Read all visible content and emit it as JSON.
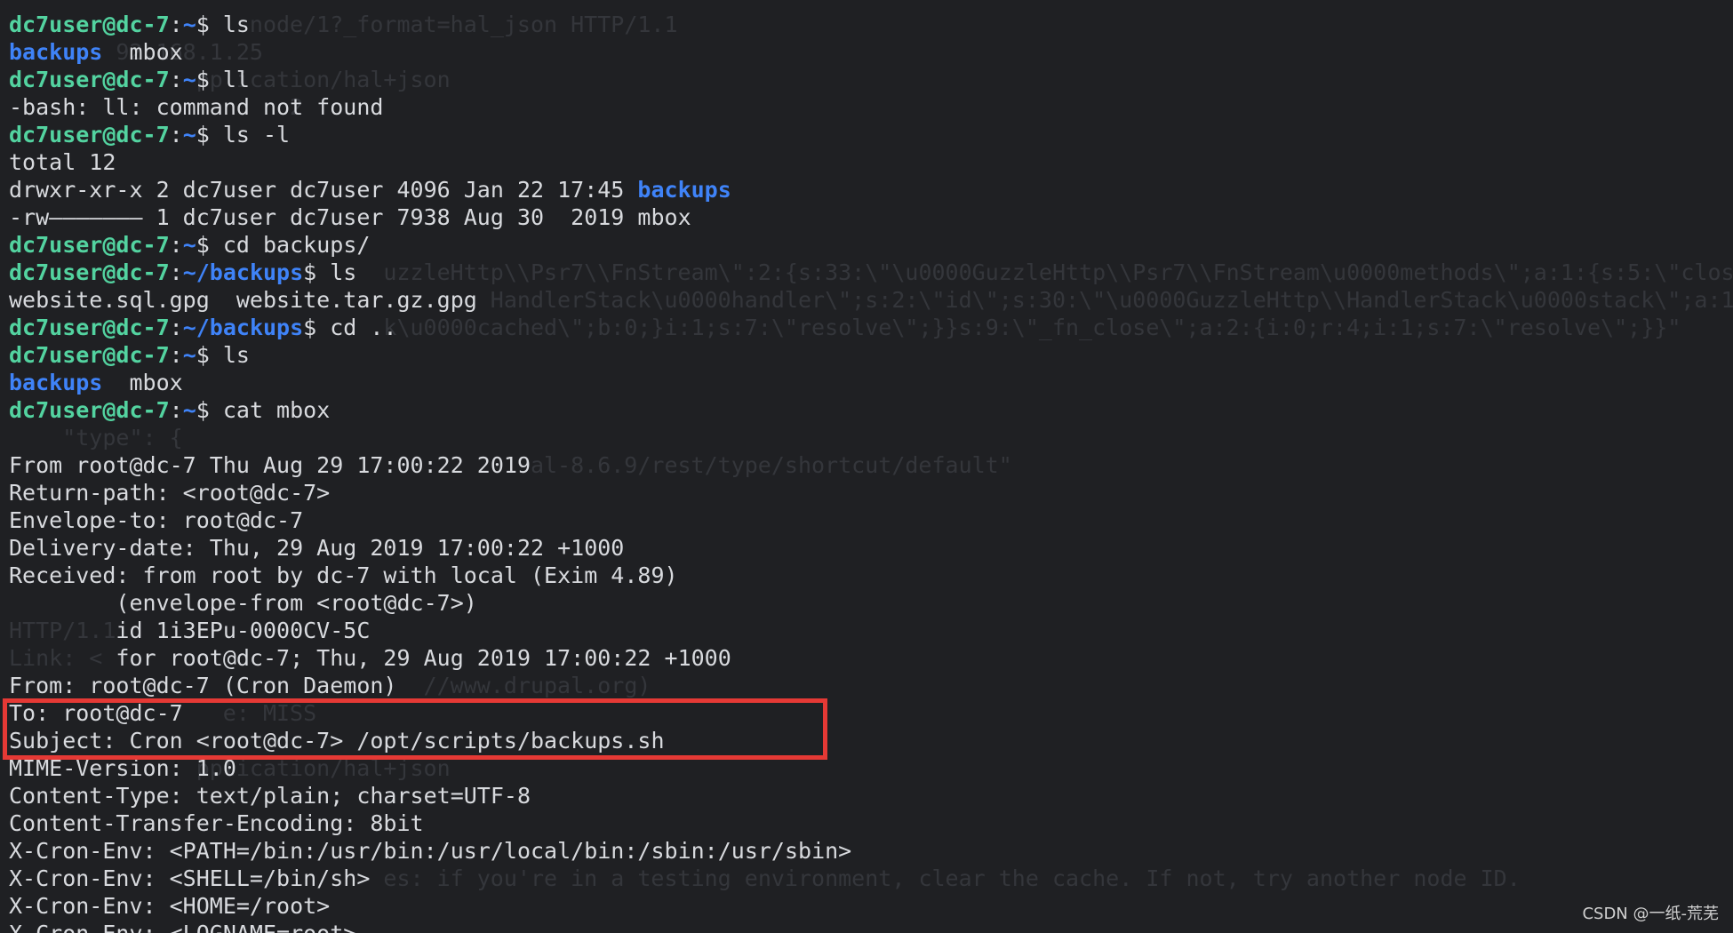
{
  "ghost_text": [
    {
      "row": 0,
      "col": 18,
      "text": "node/1?_format=hal_json HTTP/1.1"
    },
    {
      "row": 1,
      "col": 8,
      "text": "92.168.1.25"
    },
    {
      "row": 2,
      "col": 14,
      "text": "pplication/hal+json"
    },
    {
      "row": 3,
      "col": 21,
      "text": "2"
    },
    {
      "row": 9,
      "col": 28,
      "text": "uzzleHttp\\\\Psr7\\\\FnStream\\\":2:{s:33:\\\"\\u0000GuzzleHttp\\\\Psr7\\\\FnStream\\u0000methods\\\";a:1:{s:5:\\\"close\\\""
    },
    {
      "row": 10,
      "col": 36,
      "text": "HandlerStack\\u0000handler\\\";s:2:\\\"id\\\";s:30:\\\"\\u0000GuzzleHttp\\\\HandlerStack\\u0000stack\\\";a:1:"
    },
    {
      "row": 11,
      "col": 28,
      "text": "k\\u0000cached\\\";b:0;}i:1;s:7:\\\"resolve\\\";}}s:9:\\\"_fn_close\\\";a:2:{i:0;r:4;i:1;s:7:\\\"resolve\\\";}}\""
    },
    {
      "row": 15,
      "col": 4,
      "text": "\"type\": {"
    },
    {
      "row": 16,
      "col": 39,
      "text": "al-8.6.9/rest/type/shortcut/default\""
    },
    {
      "row": 22,
      "col": 0,
      "text": "HTTP/1.1"
    },
    {
      "row": 23,
      "col": 0,
      "text": "Link: <"
    },
    {
      "row": 24,
      "col": 31,
      "text": "//www.drupal.org)"
    },
    {
      "row": 25,
      "col": 16,
      "text": "e: MISS"
    },
    {
      "row": 27,
      "col": 14,
      "text": "pplication/hal+json"
    },
    {
      "row": 31,
      "col": 28,
      "text": "es: if you're in a testing environment, clear the cache. If not, try another node ID."
    }
  ],
  "lines": [
    [
      {
        "t": "dc7user@dc-7",
        "c": "prompt-user"
      },
      {
        "t": ":",
        "c": "prompt-colon"
      },
      {
        "t": "~",
        "c": "prompt-path"
      },
      {
        "t": "$ ls",
        "c": "prompt-dollar"
      }
    ],
    [
      {
        "t": "backups",
        "c": "dir"
      },
      {
        "t": "  mbox",
        "c": "plain"
      }
    ],
    [
      {
        "t": "dc7user@dc-7",
        "c": "prompt-user"
      },
      {
        "t": ":",
        "c": "prompt-colon"
      },
      {
        "t": "~",
        "c": "prompt-path"
      },
      {
        "t": "$ ll",
        "c": "prompt-dollar"
      }
    ],
    [
      {
        "t": "-bash: ll: command not found",
        "c": "plain"
      }
    ],
    [
      {
        "t": "dc7user@dc-7",
        "c": "prompt-user"
      },
      {
        "t": ":",
        "c": "prompt-colon"
      },
      {
        "t": "~",
        "c": "prompt-path"
      },
      {
        "t": "$ ls -l",
        "c": "prompt-dollar"
      }
    ],
    [
      {
        "t": "total 12",
        "c": "plain"
      }
    ],
    [
      {
        "t": "drwxr-xr-x 2 dc7user dc7user 4096 Jan 22 17:45 ",
        "c": "plain"
      },
      {
        "t": "backups",
        "c": "dir"
      }
    ],
    [
      {
        "t": "-rw——————— 1 dc7user dc7user 7938 Aug 30  2019 mbox",
        "c": "plain"
      }
    ],
    [
      {
        "t": "dc7user@dc-7",
        "c": "prompt-user"
      },
      {
        "t": ":",
        "c": "prompt-colon"
      },
      {
        "t": "~",
        "c": "prompt-path"
      },
      {
        "t": "$ cd backups/",
        "c": "prompt-dollar"
      }
    ],
    [
      {
        "t": "dc7user@dc-7",
        "c": "prompt-user"
      },
      {
        "t": ":",
        "c": "prompt-colon"
      },
      {
        "t": "~/backups",
        "c": "prompt-path"
      },
      {
        "t": "$ ls",
        "c": "prompt-dollar"
      }
    ],
    [
      {
        "t": "website.sql.gpg  website.tar.gz.gpg",
        "c": "plain"
      }
    ],
    [
      {
        "t": "dc7user@dc-7",
        "c": "prompt-user"
      },
      {
        "t": ":",
        "c": "prompt-colon"
      },
      {
        "t": "~/backups",
        "c": "prompt-path"
      },
      {
        "t": "$ cd ..",
        "c": "prompt-dollar"
      }
    ],
    [
      {
        "t": "dc7user@dc-7",
        "c": "prompt-user"
      },
      {
        "t": ":",
        "c": "prompt-colon"
      },
      {
        "t": "~",
        "c": "prompt-path"
      },
      {
        "t": "$ ls",
        "c": "prompt-dollar"
      }
    ],
    [
      {
        "t": "backups",
        "c": "dir"
      },
      {
        "t": "  mbox",
        "c": "plain"
      }
    ],
    [
      {
        "t": "dc7user@dc-7",
        "c": "prompt-user"
      },
      {
        "t": ":",
        "c": "prompt-colon"
      },
      {
        "t": "~",
        "c": "prompt-path"
      },
      {
        "t": "$ cat mbox",
        "c": "prompt-dollar"
      }
    ],
    [
      {
        "t": "",
        "c": "plain"
      }
    ],
    [
      {
        "t": "From root@dc-7 Thu Aug 29 17:00:22 2019",
        "c": "plain"
      }
    ],
    [
      {
        "t": "Return-path: <root@dc-7>",
        "c": "plain"
      }
    ],
    [
      {
        "t": "Envelope-to: root@dc-7",
        "c": "plain"
      }
    ],
    [
      {
        "t": "Delivery-date: Thu, 29 Aug 2019 17:00:22 +1000",
        "c": "plain"
      }
    ],
    [
      {
        "t": "Received: from root by dc-7 with local (Exim 4.89)",
        "c": "plain"
      }
    ],
    [
      {
        "t": "        (envelope-from <root@dc-7>)",
        "c": "plain"
      }
    ],
    [
      {
        "t": "        id 1i3EPu-0000CV-5C",
        "c": "plain"
      }
    ],
    [
      {
        "t": "        for root@dc-7; Thu, 29 Aug 2019 17:00:22 +1000",
        "c": "plain"
      }
    ],
    [
      {
        "t": "From: root@dc-7 (Cron Daemon)",
        "c": "plain"
      }
    ],
    [
      {
        "t": "To: root@dc-7",
        "c": "plain"
      }
    ],
    [
      {
        "t": "Subject: Cron <root@dc-7> /opt/scripts/backups.sh",
        "c": "plain"
      }
    ],
    [
      {
        "t": "MIME-Version: 1.0",
        "c": "plain"
      }
    ],
    [
      {
        "t": "Content-Type: text/plain; charset=UTF-8",
        "c": "plain"
      }
    ],
    [
      {
        "t": "Content-Transfer-Encoding: 8bit",
        "c": "plain"
      }
    ],
    [
      {
        "t": "X-Cron-Env: <PATH=/bin:/usr/bin:/usr/local/bin:/sbin:/usr/sbin>",
        "c": "plain"
      }
    ],
    [
      {
        "t": "X-Cron-Env: <SHELL=/bin/sh>",
        "c": "plain"
      }
    ],
    [
      {
        "t": "X-Cron-Env: <HOME=/root>",
        "c": "plain"
      }
    ],
    [
      {
        "t": "X-Cron-Env: <LOGNAME=root>",
        "c": "plain"
      }
    ]
  ],
  "highlight": {
    "color": "#e53935"
  },
  "watermark": "CSDN @一纸-荒芜",
  "colors": {
    "background": "#1f2023",
    "prompt": "#53d3a0",
    "directory": "#3f83f8",
    "text": "#d8dade",
    "ghost": "#34363b"
  }
}
